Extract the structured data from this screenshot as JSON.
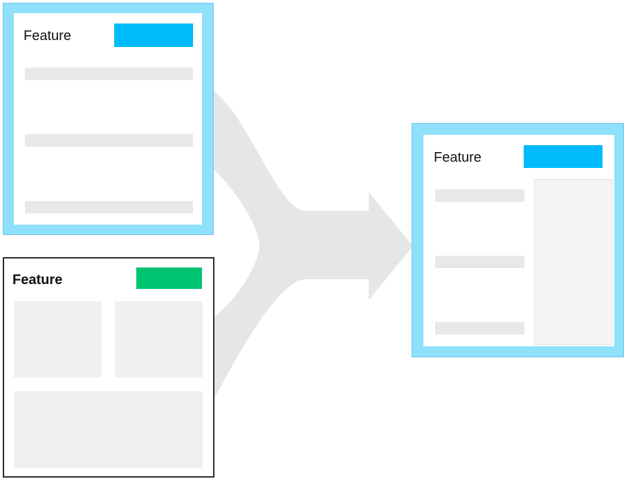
{
  "colors": {
    "frame_blue": "#8ee0fb",
    "accent_blue": "#00bbf9",
    "accent_green": "#00c46f",
    "placeholder_grey": "#e8e8e8",
    "arrow_grey": "#e6e6e6",
    "frame_dark": "#2a2a2a"
  },
  "card_a": {
    "title": "Feature"
  },
  "card_b": {
    "title": "Feature"
  },
  "card_c": {
    "title": "Feature"
  }
}
